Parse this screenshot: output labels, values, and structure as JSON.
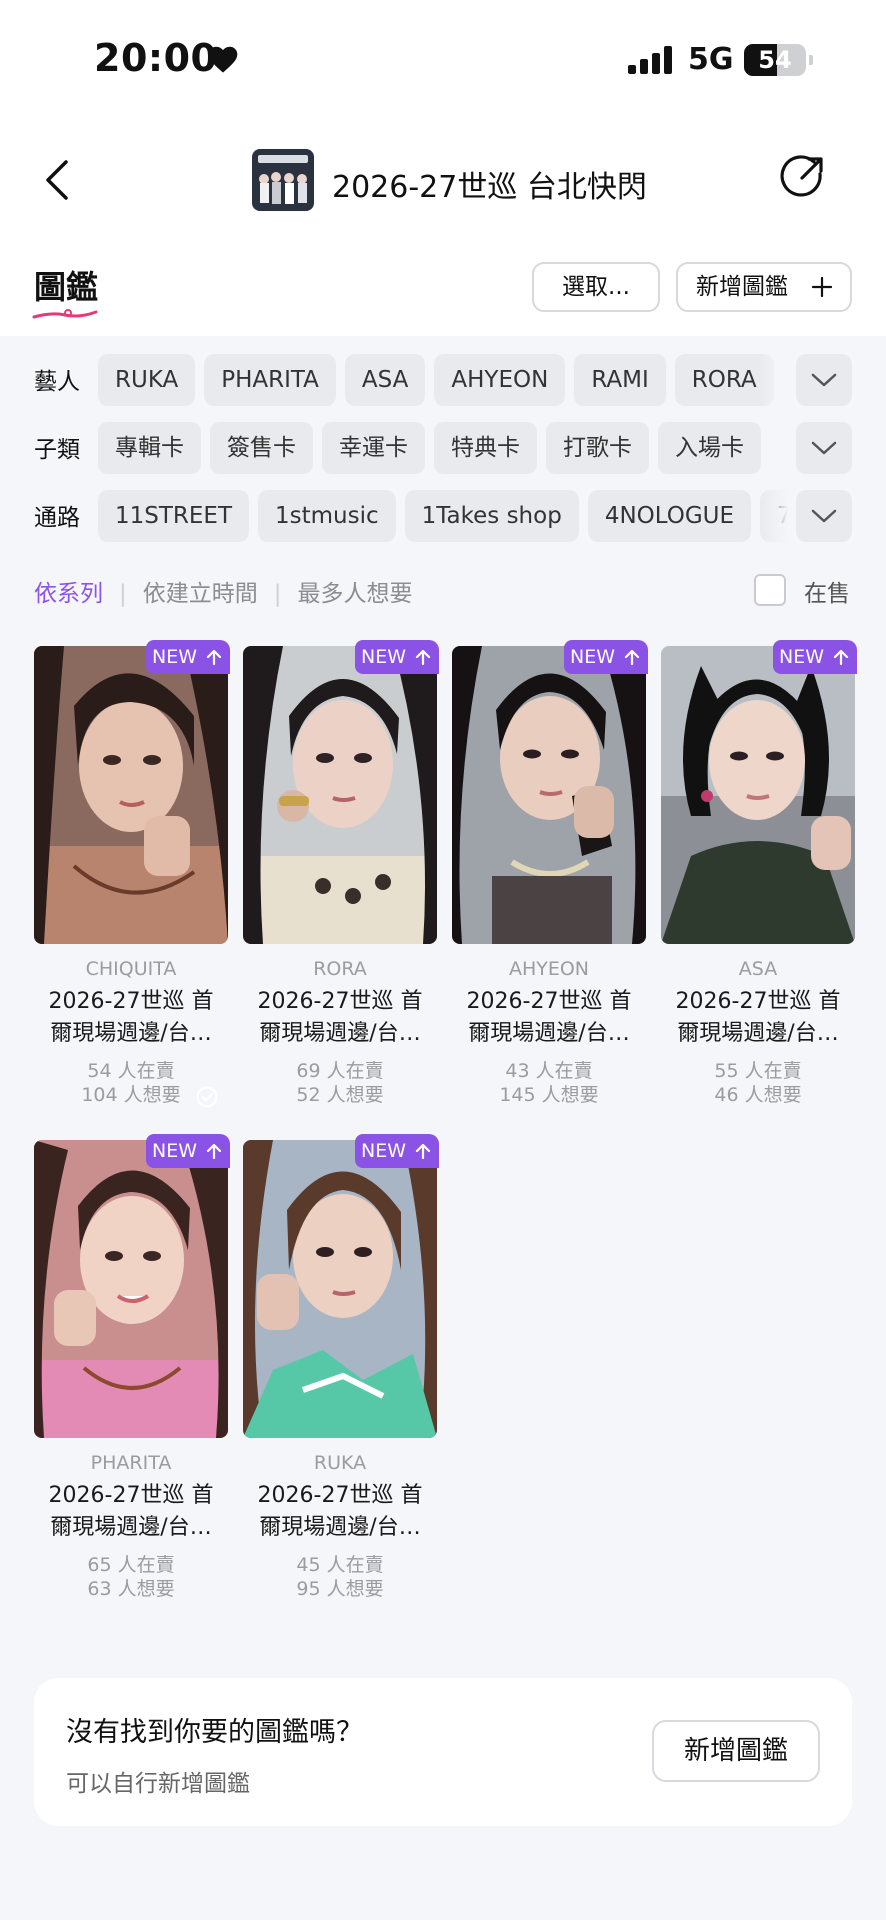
{
  "status_bar": {
    "time": "20:00",
    "network": "5G",
    "battery": "54",
    "battery_level": 0.54
  },
  "header": {
    "title": "2026-27世巡 台北快閃"
  },
  "section": {
    "title": "圖鑑",
    "select_label": "選取...",
    "add_label": "新增圖鑑"
  },
  "filters": [
    {
      "label": "藝人",
      "chips": [
        "RUKA",
        "PHARITA",
        "ASA",
        "AHYEON",
        "RAMI",
        "RORA"
      ]
    },
    {
      "label": "子類",
      "chips": [
        "專輯卡",
        "簽售卡",
        "幸運卡",
        "特典卡",
        "打歌卡",
        "入場卡"
      ]
    },
    {
      "label": "通路",
      "chips": [
        "11STREET",
        "1stmusic",
        "1Takes shop",
        "4NOLOGUE",
        "7"
      ]
    }
  ],
  "sort": {
    "options": [
      "依系列",
      "依建立時間",
      "最多人想要"
    ],
    "active": "依系列",
    "on_sale_label": "在售"
  },
  "cards": [
    {
      "artist": "CHIQUITA",
      "title_line1": "2026-27世巡 首",
      "title_line2": "爾現場週邊/台…",
      "selling": "54 人在賣",
      "wanted": "104 人想要",
      "badge": "NEW",
      "owned": true
    },
    {
      "artist": "RORA",
      "title_line1": "2026-27世巡 首",
      "title_line2": "爾現場週邊/台…",
      "selling": "69 人在賣",
      "wanted": "52 人想要",
      "badge": "NEW",
      "owned": false
    },
    {
      "artist": "AHYEON",
      "title_line1": "2026-27世巡 首",
      "title_line2": "爾現場週邊/台…",
      "selling": "43 人在賣",
      "wanted": "145 人想要",
      "badge": "NEW",
      "owned": false
    },
    {
      "artist": "ASA",
      "title_line1": "2026-27世巡 首",
      "title_line2": "爾現場週邊/台…",
      "selling": "55 人在賣",
      "wanted": "46 人想要",
      "badge": "NEW",
      "owned": false
    },
    {
      "artist": "PHARITA",
      "title_line1": "2026-27世巡 首",
      "title_line2": "爾現場週邊/台…",
      "selling": "65 人在賣",
      "wanted": "63 人想要",
      "badge": "NEW",
      "owned": false
    },
    {
      "artist": "RUKA",
      "title_line1": "2026-27世巡 首",
      "title_line2": "爾現場週邊/台…",
      "selling": "45 人在賣",
      "wanted": "95 人想要",
      "badge": "NEW",
      "owned": false
    }
  ],
  "empty_panel": {
    "title": "沒有找到你要的圖鑑嗎？",
    "subtitle": "可以自行新增圖鑑",
    "button_label": "新增圖鑑"
  },
  "colors": {
    "accent": "#8a53e6",
    "chip_bg": "#e9eaee",
    "page_bg": "#f5f6f9",
    "underline": "#e5397a"
  }
}
